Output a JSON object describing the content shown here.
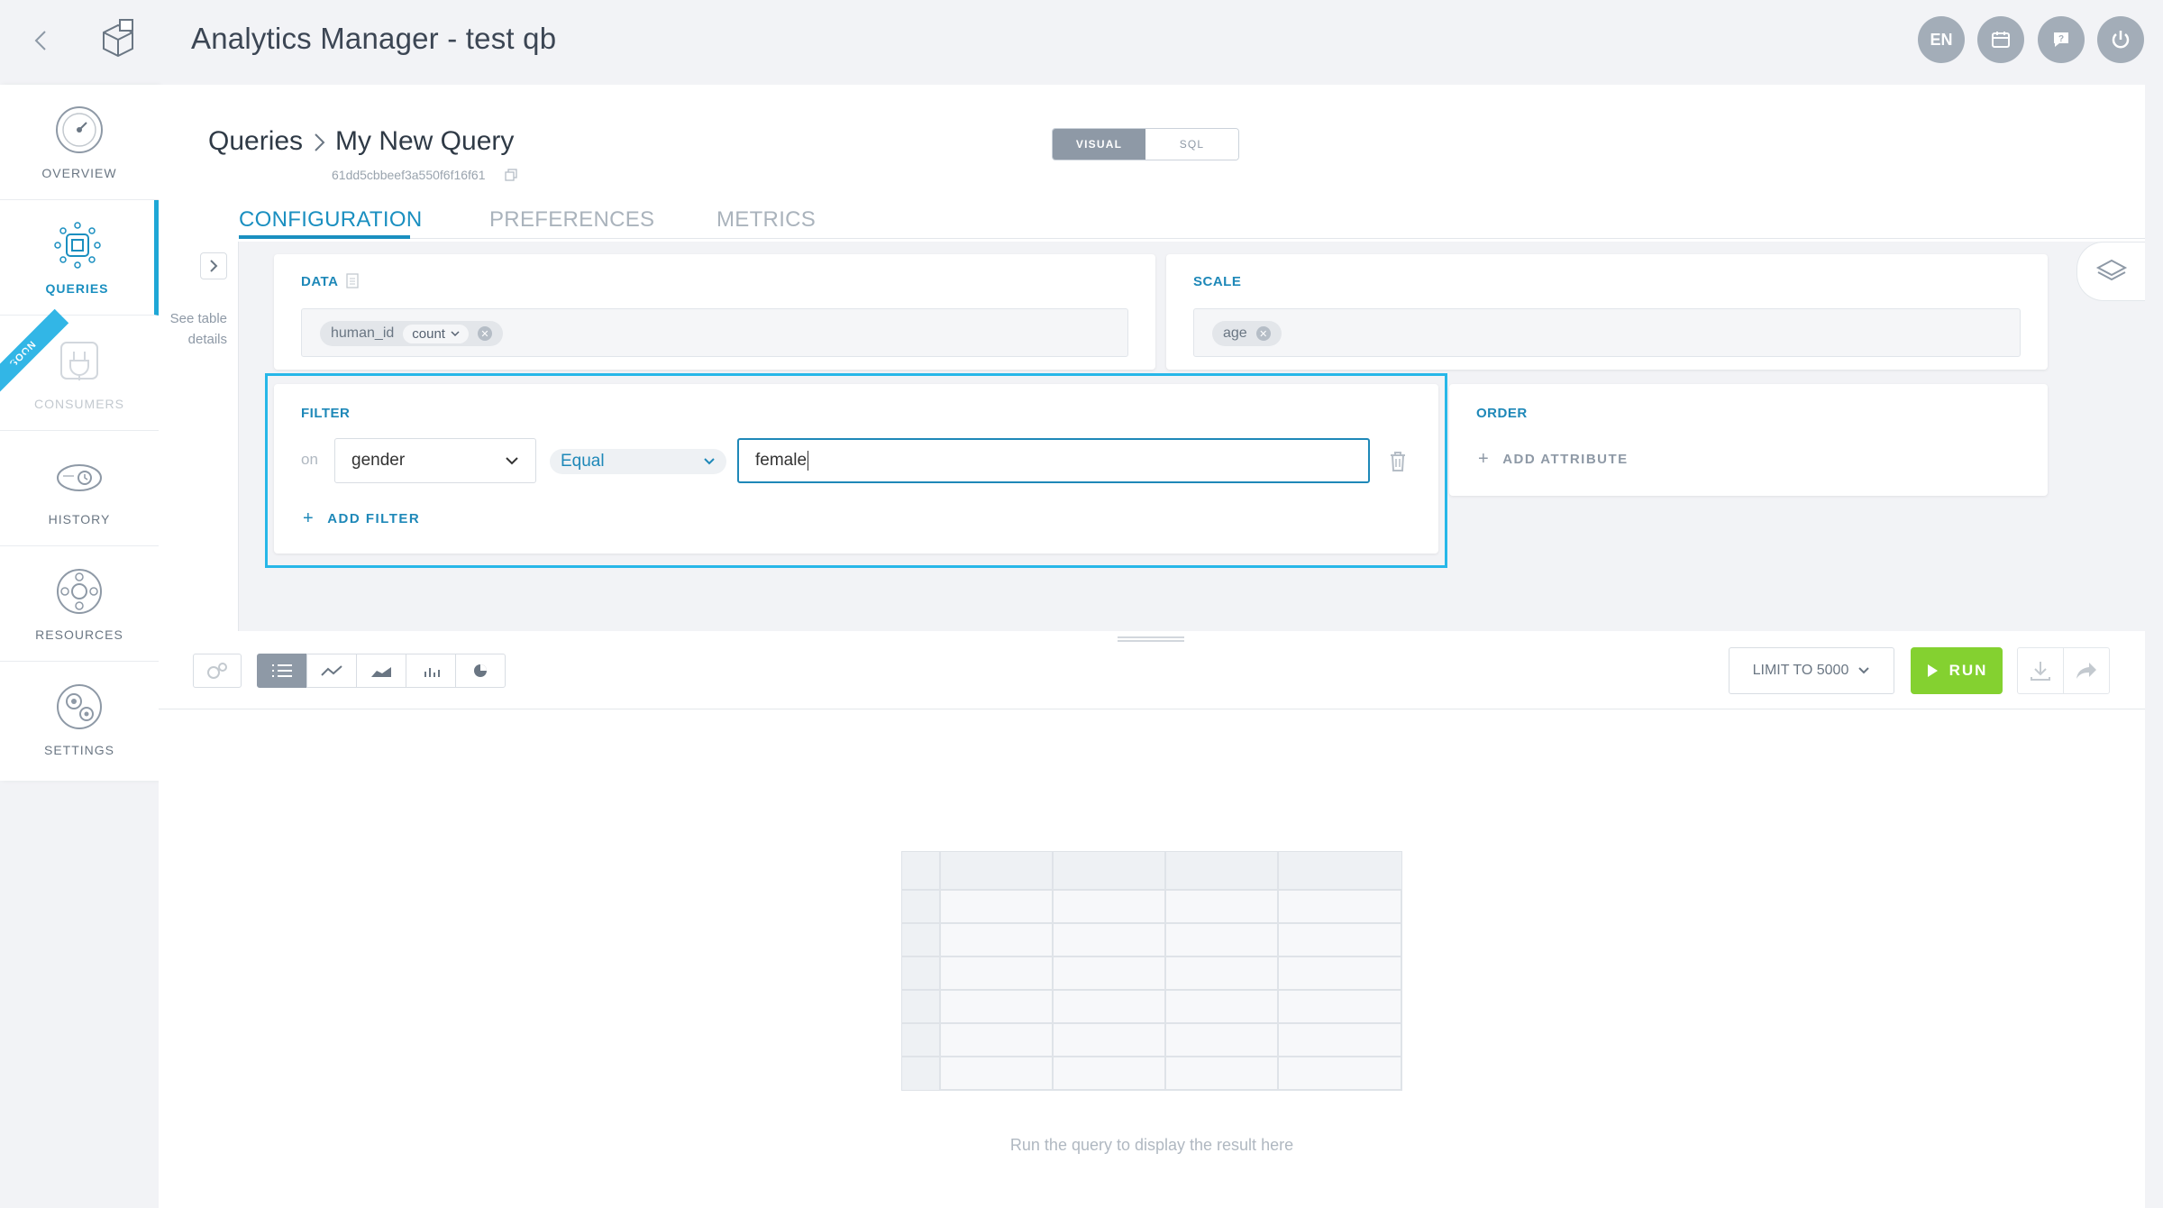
{
  "header": {
    "title": "Analytics Manager - test qb",
    "language": "EN"
  },
  "sidebar": {
    "items": [
      {
        "label": "OVERVIEW"
      },
      {
        "label": "QUERIES"
      },
      {
        "label": "CONSUMERS"
      },
      {
        "label": "HISTORY"
      },
      {
        "label": "RESOURCES"
      },
      {
        "label": "SETTINGS"
      }
    ],
    "soon_badge": "SOON"
  },
  "breadcrumb": {
    "root": "Queries",
    "current": "My New Query",
    "query_id": "61dd5cbbeef3a550f6f16f61"
  },
  "mode_toggle": {
    "visual": "VISUAL",
    "sql": "SQL",
    "active": "VISUAL"
  },
  "tabs": [
    {
      "label": "CONFIGURATION",
      "active": true
    },
    {
      "label": "PREFERENCES",
      "active": false
    },
    {
      "label": "METRICS",
      "active": false
    }
  ],
  "table_details": {
    "line1": "See table",
    "line2": "details"
  },
  "data_card": {
    "title": "DATA",
    "chip_label": "human_id",
    "aggregation": "count"
  },
  "scale_card": {
    "title": "SCALE",
    "chip_label": "age"
  },
  "filter_card": {
    "title": "FILTER",
    "on_label": "on",
    "attribute": "gender",
    "operator": "Equal",
    "value": "female",
    "add_label": "ADD FILTER"
  },
  "order_card": {
    "title": "ORDER",
    "add_label": "ADD ATTRIBUTE"
  },
  "toolbar": {
    "limit_label": "LIMIT TO 5000",
    "run_label": "RUN",
    "active_view": "table"
  },
  "result": {
    "empty_message": "Run the query to display the result here"
  },
  "colors": {
    "accent": "#1a8fc0",
    "highlight": "#27b7e8",
    "run": "#84d130",
    "background": "#f2f3f6"
  }
}
